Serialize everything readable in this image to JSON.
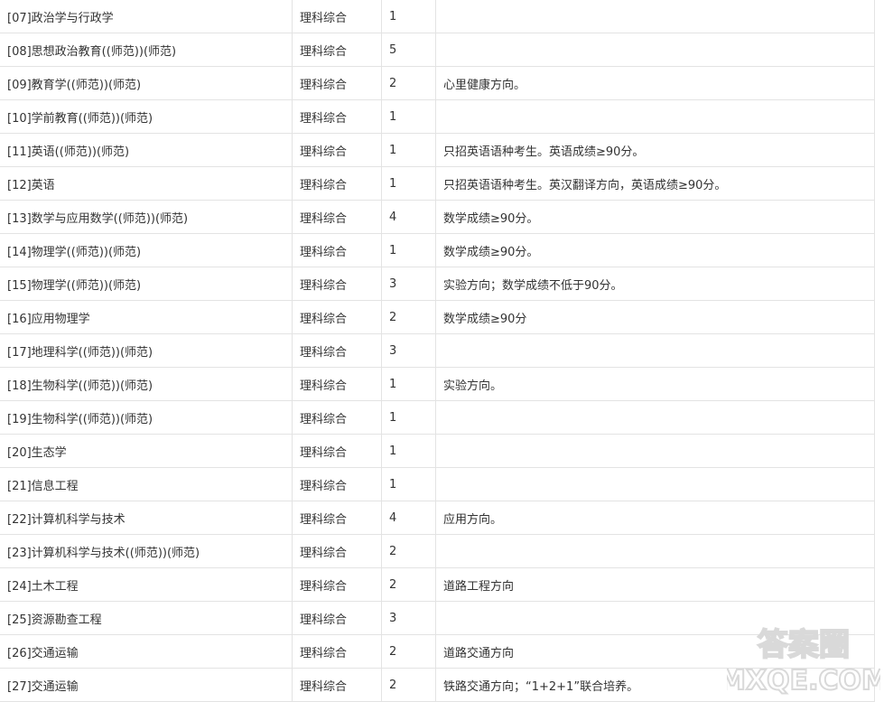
{
  "table": {
    "rows": [
      {
        "major": "[07]政治学与行政学",
        "subject": "理科综合",
        "count": "1",
        "note": ""
      },
      {
        "major": "[08]思想政治教育((师范))(师范)",
        "subject": "理科综合",
        "count": "5",
        "note": ""
      },
      {
        "major": "[09]教育学((师范))(师范)",
        "subject": "理科综合",
        "count": "2",
        "note": "心里健康方向。"
      },
      {
        "major": "[10]学前教育((师范))(师范)",
        "subject": "理科综合",
        "count": "1",
        "note": ""
      },
      {
        "major": "[11]英语((师范))(师范)",
        "subject": "理科综合",
        "count": "1",
        "note": "只招英语语种考生。英语成绩≥90分。"
      },
      {
        "major": "[12]英语",
        "subject": "理科综合",
        "count": "1",
        "note": "只招英语语种考生。英汉翻译方向，英语成绩≥90分。"
      },
      {
        "major": "[13]数学与应用数学((师范))(师范)",
        "subject": "理科综合",
        "count": "4",
        "note": "数学成绩≥90分。"
      },
      {
        "major": "[14]物理学((师范))(师范)",
        "subject": "理科综合",
        "count": "1",
        "note": "数学成绩≥90分。"
      },
      {
        "major": "[15]物理学((师范))(师范)",
        "subject": "理科综合",
        "count": "3",
        "note": "实验方向；数学成绩不低于90分。"
      },
      {
        "major": "[16]应用物理学",
        "subject": "理科综合",
        "count": "2",
        "note": "数学成绩≥90分"
      },
      {
        "major": "[17]地理科学((师范))(师范)",
        "subject": "理科综合",
        "count": "3",
        "note": ""
      },
      {
        "major": "[18]生物科学((师范))(师范)",
        "subject": "理科综合",
        "count": "1",
        "note": "实验方向。"
      },
      {
        "major": "[19]生物科学((师范))(师范)",
        "subject": "理科综合",
        "count": "1",
        "note": ""
      },
      {
        "major": "[20]生态学",
        "subject": "理科综合",
        "count": "1",
        "note": ""
      },
      {
        "major": "[21]信息工程",
        "subject": "理科综合",
        "count": "1",
        "note": ""
      },
      {
        "major": "[22]计算机科学与技术",
        "subject": "理科综合",
        "count": "4",
        "note": "应用方向。"
      },
      {
        "major": "[23]计算机科学与技术((师范))(师范)",
        "subject": "理科综合",
        "count": "2",
        "note": ""
      },
      {
        "major": "[24]土木工程",
        "subject": "理科综合",
        "count": "2",
        "note": "道路工程方向"
      },
      {
        "major": "[25]资源勘查工程",
        "subject": "理科综合",
        "count": "3",
        "note": ""
      },
      {
        "major": "[26]交通运输",
        "subject": "理科综合",
        "count": "2",
        "note": "道路交通方向"
      },
      {
        "major": "[27]交通运输",
        "subject": "理科综合",
        "count": "2",
        "note": "铁路交通方向；“1+2+1”联合培养。"
      }
    ]
  },
  "watermark": {
    "top": "答案圈",
    "bottom": "MXQE.COM",
    "color": "#d9d9d9"
  }
}
